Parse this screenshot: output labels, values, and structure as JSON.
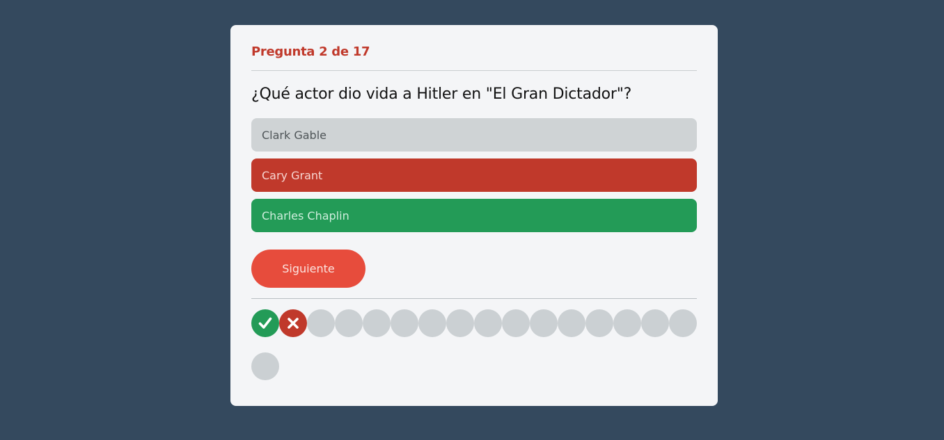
{
  "quiz": {
    "counter": "Pregunta 2 de 17",
    "question": "¿Qué actor dio vida a Hitler en \"El Gran Dictador\"?",
    "options": [
      {
        "label": "Clark Gable",
        "state": "neutral"
      },
      {
        "label": "Cary Grant",
        "state": "wrong"
      },
      {
        "label": "Charles Chaplin",
        "state": "right"
      }
    ],
    "next_label": "Siguiente",
    "progress": {
      "total": 17,
      "states": [
        "correct",
        "incorrect",
        "pending",
        "pending",
        "pending",
        "pending",
        "pending",
        "pending",
        "pending",
        "pending",
        "pending",
        "pending",
        "pending",
        "pending",
        "pending",
        "pending",
        "pending"
      ],
      "icons": {
        "correct": "check-icon",
        "incorrect": "x-icon"
      }
    }
  },
  "colors": {
    "background": "#34495e",
    "card": "#f4f5f7",
    "accent_red": "#c0392b",
    "button": "#e74c3c",
    "correct_green": "#239b57",
    "neutral_gray": "#cfd3d5"
  }
}
